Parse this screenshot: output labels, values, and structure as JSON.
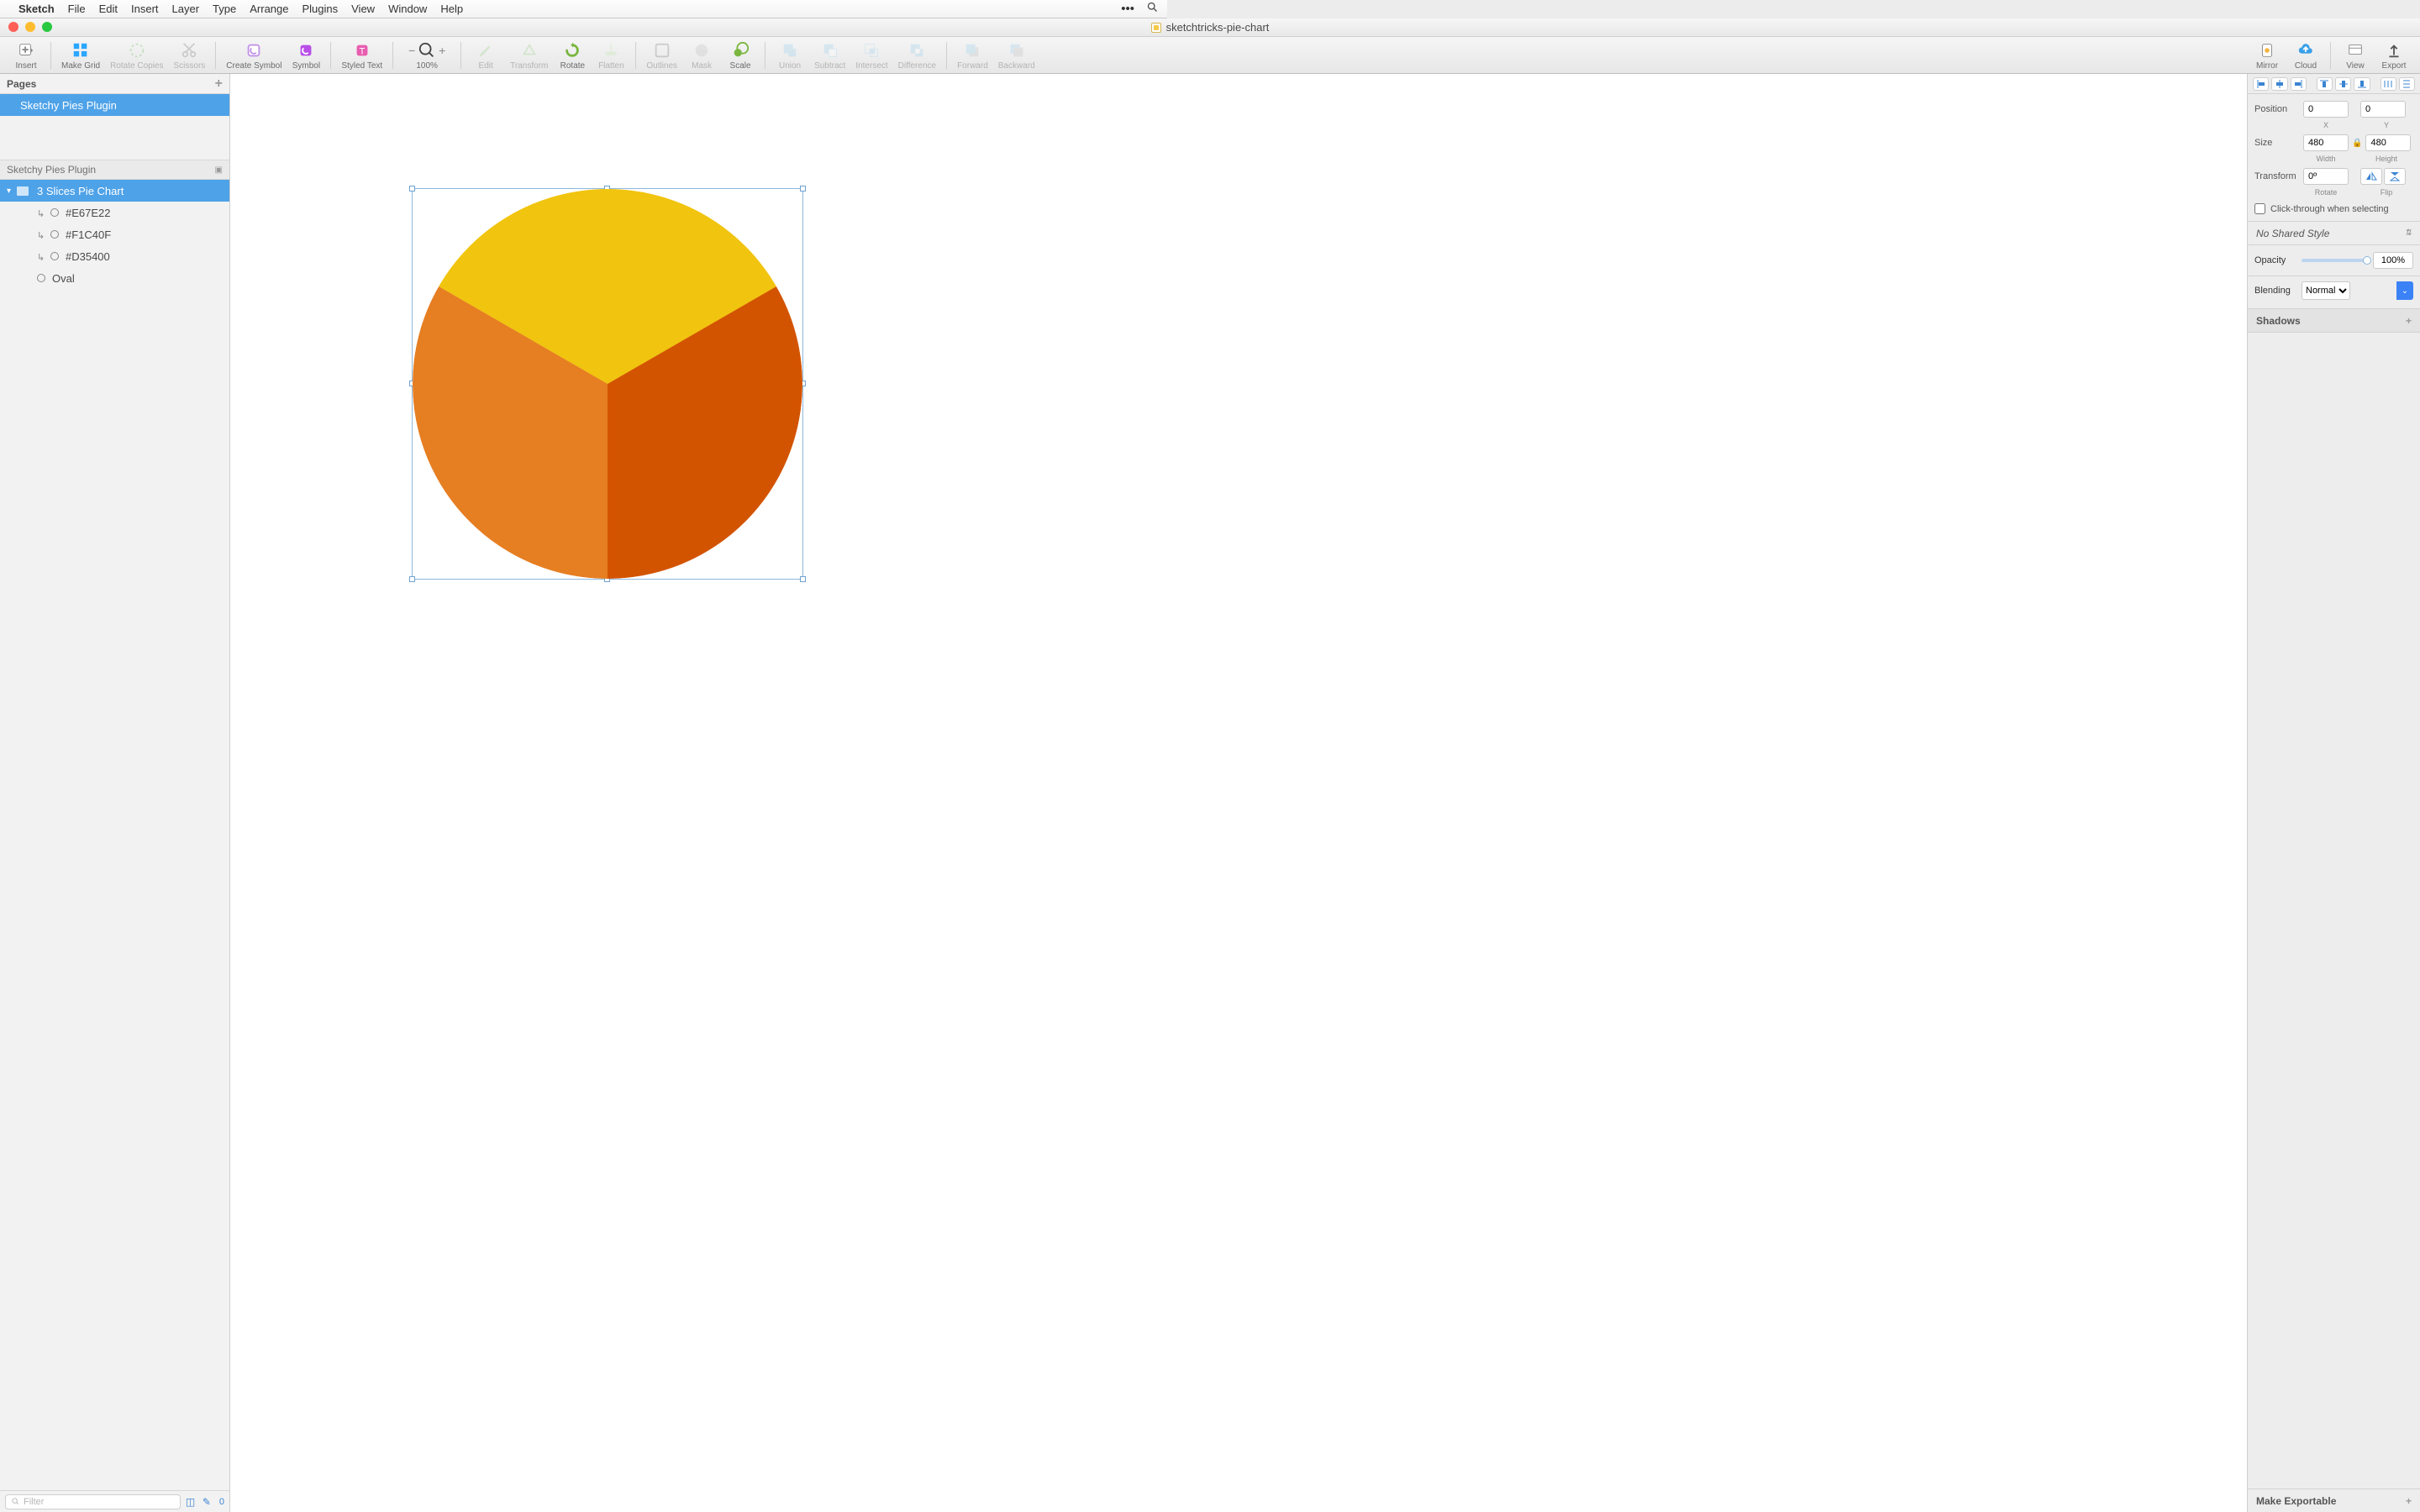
{
  "menubar": {
    "app": "Sketch",
    "items": [
      "File",
      "Edit",
      "Insert",
      "Layer",
      "Type",
      "Arrange",
      "Plugins",
      "View",
      "Window",
      "Help"
    ]
  },
  "window": {
    "title": "sketchtricks-pie-chart"
  },
  "toolbar": {
    "insert": "Insert",
    "make_grid": "Make Grid",
    "rotate_copies": "Rotate Copies",
    "scissors": "Scissors",
    "create_symbol": "Create Symbol",
    "symbol": "Symbol",
    "styled_text": "Styled Text",
    "zoom": "100%",
    "edit": "Edit",
    "transform": "Transform",
    "rotate": "Rotate",
    "flatten": "Flatten",
    "outlines": "Outlines",
    "mask": "Mask",
    "scale": "Scale",
    "union": "Union",
    "subtract": "Subtract",
    "intersect": "Intersect",
    "difference": "Difference",
    "forward": "Forward",
    "backward": "Backward",
    "mirror": "Mirror",
    "cloud": "Cloud",
    "view": "View",
    "export": "Export"
  },
  "pages": {
    "header": "Pages",
    "page1": "Sketchy Pies Plugin",
    "artboard_header": "Sketchy Pies Plugin"
  },
  "layers": {
    "group": "3 Slices Pie Chart",
    "l1": "#E67E22",
    "l2": "#F1C40F",
    "l3": "#D35400",
    "l4": "Oval"
  },
  "filter": {
    "placeholder": "Filter",
    "count": "0"
  },
  "inspector": {
    "position": "Position",
    "x": "0",
    "y": "0",
    "xlab": "X",
    "ylab": "Y",
    "size": "Size",
    "w": "480",
    "h": "480",
    "wlab": "Width",
    "hlab": "Height",
    "transform": "Transform",
    "rot": "0º",
    "rotlab": "Rotate",
    "fliplab": "Flip",
    "clickthrough": "Click-through when selecting",
    "no_style": "No Shared Style",
    "opacity": "Opacity",
    "op_val": "100%",
    "blending": "Blending",
    "blend_val": "Normal",
    "shadows": "Shadows",
    "make_exp": "Make Exportable"
  },
  "chart_data": {
    "type": "pie",
    "title": "3 Slices Pie Chart",
    "series": [
      {
        "name": "#F1C40F",
        "value": 33.33,
        "color": "#F1C40F"
      },
      {
        "name": "#D35400",
        "value": 33.33,
        "color": "#D35400"
      },
      {
        "name": "#E67E22",
        "value": 33.33,
        "color": "#E67E22"
      }
    ]
  },
  "colors": {
    "slice_yellow": "#F1C40F",
    "slice_dark": "#D35400",
    "slice_orange": "#E67E22",
    "selection": "#4ea2e8"
  }
}
